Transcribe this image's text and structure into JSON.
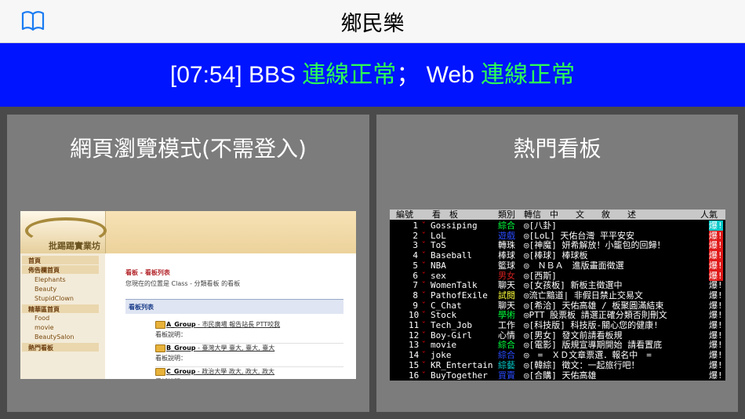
{
  "app": {
    "title": "鄉民樂"
  },
  "status": {
    "time": "[07:54]",
    "bbs_label": " BBS ",
    "bbs_state": "連線正常",
    "sep": "；",
    "web_label": " Web ",
    "web_state": "連線正常"
  },
  "panels": {
    "web_mode": {
      "title": "網頁瀏覽模式(不需登入)"
    },
    "hot_boards": {
      "title": "熱門看板"
    }
  },
  "web_preview": {
    "logo_text": "批踢踢實業坊",
    "sidebar": [
      {
        "label": "首頁",
        "type": "head"
      },
      {
        "label": "佈告欄首頁",
        "type": "head"
      },
      {
        "label": "Elephants",
        "type": "sub"
      },
      {
        "label": "Beauty",
        "type": "sub"
      },
      {
        "label": "StupidClown",
        "type": "sub"
      },
      {
        "label": "精華區首頁",
        "type": "head"
      },
      {
        "label": "Food",
        "type": "sub"
      },
      {
        "label": "movie",
        "type": "sub"
      },
      {
        "label": "BeautySalon",
        "type": "sub"
      },
      {
        "label": "熱門看板",
        "type": "head"
      }
    ],
    "breadcrumb": "看板 - 看板列表",
    "location": "您現在的位置是 Class - 分類看板 的看板",
    "list_title": "看板列表",
    "groups": [
      {
        "name": "A_Group",
        "desc": " - 市民廣場 報告站長 PTT咬我",
        "note": "看板說明："
      },
      {
        "name": "B_Group",
        "desc": " - 臺灣大學 臺大, 臺大, 臺大",
        "note": "看板說明："
      },
      {
        "name": "C_Group",
        "desc": " - 政治大學 政大, 政大, 政大",
        "note": "看板說明："
      }
    ]
  },
  "terminal": {
    "header": {
      "num": "編號",
      "board": "看　板",
      "cat": "類別",
      "title": "轉信　中　　文　　敘　　述",
      "hot": "人氣"
    },
    "rows": [
      {
        "num": "1",
        "board": "Gossiping",
        "cat": "綜合",
        "cat_color": "#00ff3c",
        "title": "◎[八卦]",
        "hot": "爆!",
        "hot_bg": "#00c8c8"
      },
      {
        "num": "2",
        "board": "LoL",
        "cat": "遊戲",
        "cat_color": "#2a4bff",
        "title": "◎[LoL] 天佑台灣 平平安安",
        "hot": "爆!",
        "hot_bg": "#e01818"
      },
      {
        "num": "3",
        "board": "ToS",
        "cat": "轉珠",
        "cat_color": "#ffffff",
        "title": "◎[神魔] 妍希解放！小籠包的回歸！",
        "hot": "爆!",
        "hot_bg": "#e01818"
      },
      {
        "num": "4",
        "board": "Baseball",
        "cat": "棒球",
        "cat_color": "#ffffff",
        "title": "◎[棒球] 棒球板",
        "hot": "爆!",
        "hot_bg": "#e01818"
      },
      {
        "num": "5",
        "board": "NBA",
        "cat": "籃球",
        "cat_color": "#ffffff",
        "title": "◎　ＮＢＡ　進版畫面徵選",
        "hot": "爆!",
        "hot_bg": "#e01818"
      },
      {
        "num": "6",
        "board": "sex",
        "cat": "男女",
        "cat_color": "#d02020",
        "title": "◎[西斯]",
        "hot": "爆!",
        "hot_bg": "#e01818"
      },
      {
        "num": "7",
        "board": "WomenTalk",
        "cat": "聊天",
        "cat_color": "#ffffff",
        "title": "◎[女孩板] 新板主徵選中",
        "hot": "爆!",
        "hot_bg": ""
      },
      {
        "num": "8",
        "board": "PathofExile",
        "cat": "試閱",
        "cat_color": "#ffff3c",
        "title": "◎流亡黯道| 非假日禁止交易文",
        "hot": "爆!",
        "hot_bg": ""
      },
      {
        "num": "9",
        "board": "C_Chat",
        "cat": "聊天",
        "cat_color": "#ffffff",
        "title": "◎[希洽] 天佑高雄 / 板聚圓滿結束",
        "hot": "爆!",
        "hot_bg": ""
      },
      {
        "num": "10",
        "board": "Stock",
        "cat": "學術",
        "cat_color": "#00ff3c",
        "title": "◎PTT 股票板 請選正確分類否則刪文",
        "hot": "爆!",
        "hot_bg": ""
      },
      {
        "num": "11",
        "board": "Tech_Job",
        "cat": "工作",
        "cat_color": "#ffffff",
        "title": "◎[科技版] 科技版-關心您的健康!",
        "hot": "爆!",
        "hot_bg": ""
      },
      {
        "num": "12",
        "board": "Boy-Girl",
        "cat": "心情",
        "cat_color": "#ffffff",
        "title": "◎[男女] 發文前請看板規",
        "hot": "爆!",
        "hot_bg": ""
      },
      {
        "num": "13",
        "board": "movie",
        "cat": "綜合",
        "cat_color": "#00ff3c",
        "title": "◎[電影] 版規宣導期開始 請看置底",
        "hot": "爆!",
        "hot_bg": ""
      },
      {
        "num": "14",
        "board": "joke",
        "cat": "綜合",
        "cat_color": "#2a4bff",
        "title": "◎　=　ＸＤ文章票選．報名中　=",
        "hot": "爆!",
        "hot_bg": ""
      },
      {
        "num": "15",
        "board": "KR_Entertain",
        "cat": "綜藝",
        "cat_color": "#00c8c8",
        "title": "◎[韓綜] 徵文：一起旅行吧！",
        "hot": "爆!",
        "hot_bg": ""
      },
      {
        "num": "16",
        "board": "BuyTogether",
        "cat": "買賣",
        "cat_color": "#2a4bff",
        "title": "◎[合購] 天佑高雄",
        "hot": "爆!",
        "hot_bg": ""
      }
    ]
  }
}
